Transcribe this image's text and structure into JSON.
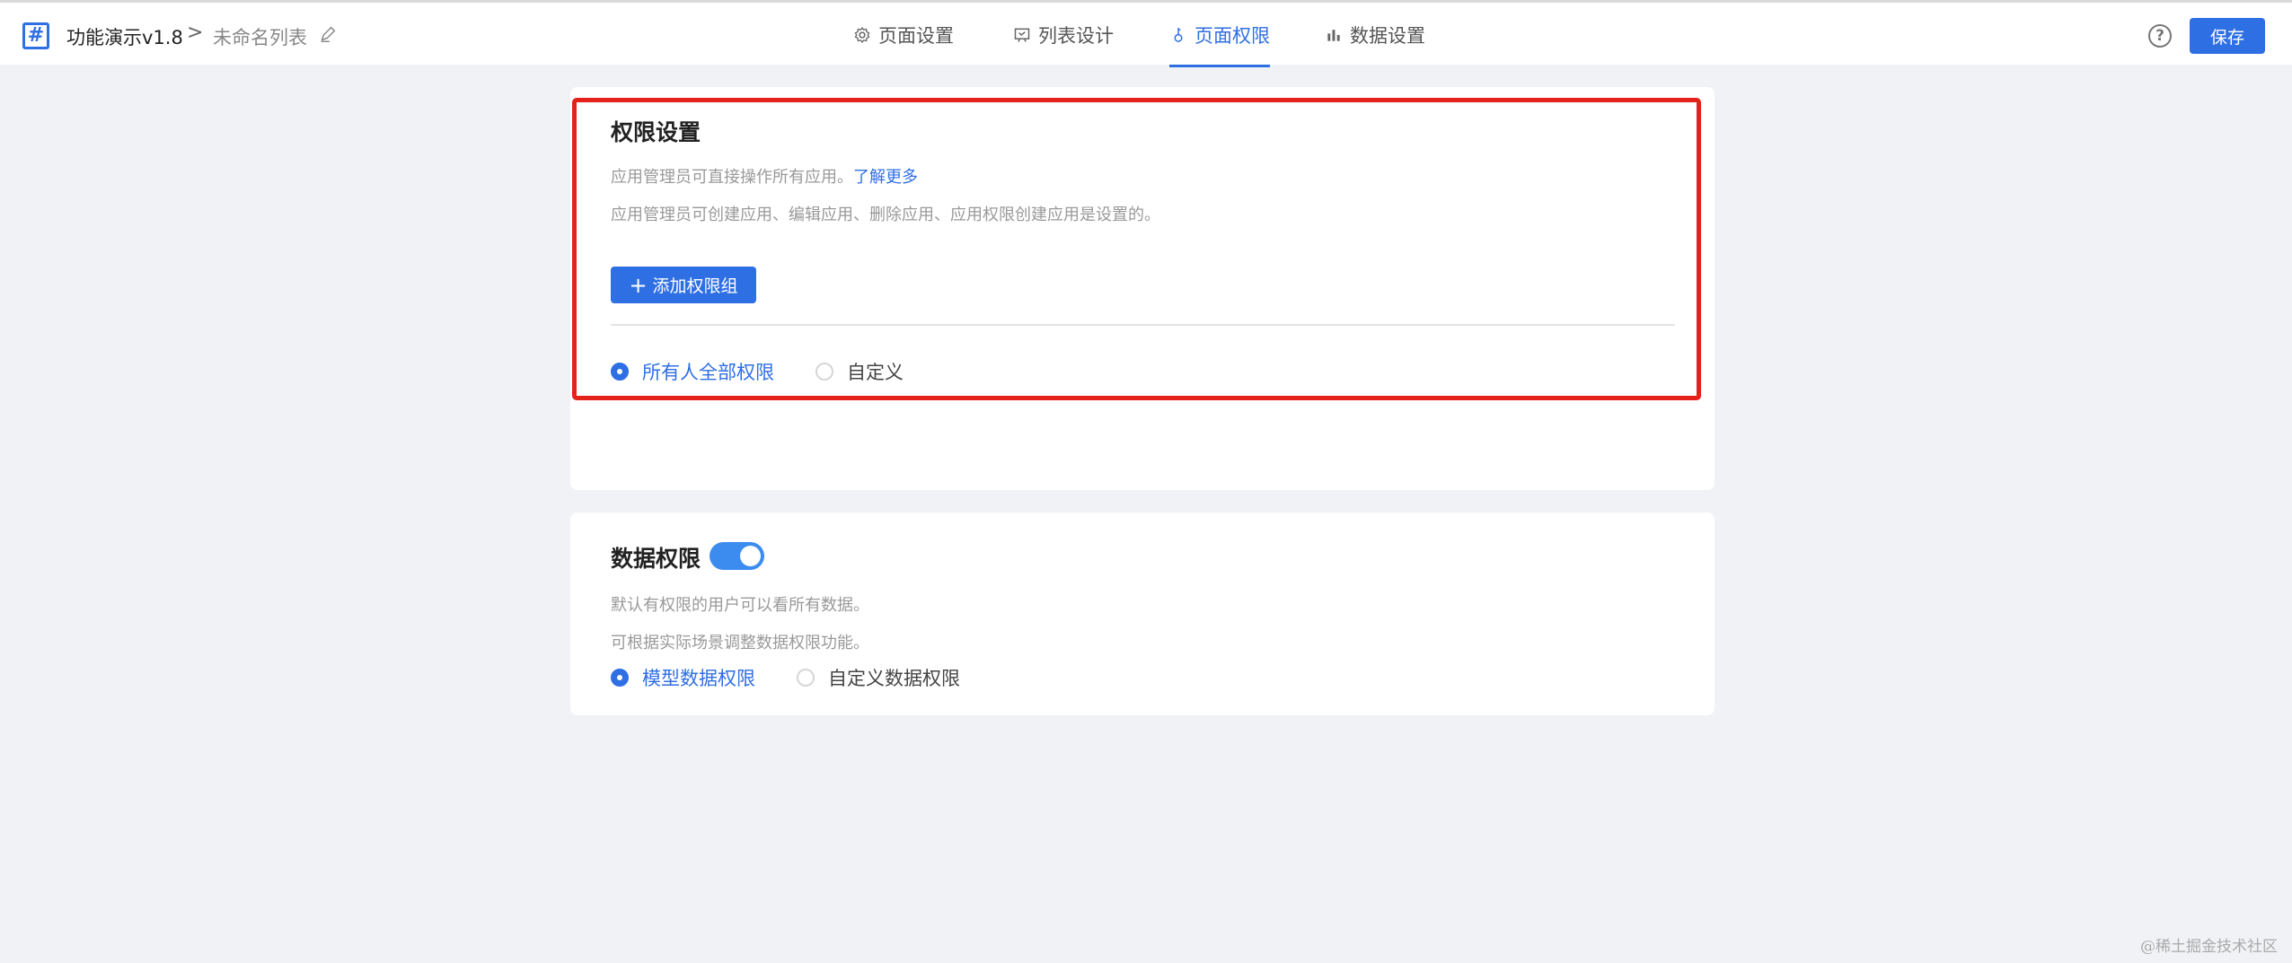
{
  "header": {
    "logo_glyph": "#",
    "app_title": "功能演示v1.8",
    "separator": ">",
    "list_name": "未命名列表",
    "tabs": [
      {
        "label": "页面设置",
        "icon": "gear-icon"
      },
      {
        "label": "列表设计",
        "icon": "list-design-icon"
      },
      {
        "label": "页面权限",
        "icon": "key-icon",
        "active": true
      },
      {
        "label": "数据设置",
        "icon": "bar-chart-icon"
      }
    ],
    "help_glyph": "?",
    "save_label": "保存"
  },
  "permission": {
    "title": "权限设置",
    "desc1": "应用管理员可直接操作所有应用。",
    "learn_more": "了解更多",
    "desc2": "应用管理员可创建应用、编辑应用、删除应用、应用权限创建应用是设置的。",
    "add_group_label": "添加权限组",
    "options": [
      {
        "label": "所有人全部权限",
        "checked": true
      },
      {
        "label": "自定义",
        "checked": false
      }
    ]
  },
  "data_permission": {
    "title": "数据权限",
    "toggle_on": true,
    "desc1": "默认有权限的用户可以看所有数据。",
    "desc2": "可根据实际场景调整数据权限功能。",
    "options": [
      {
        "label": "模型数据权限",
        "checked": true
      },
      {
        "label": "自定义数据权限",
        "checked": false
      }
    ]
  },
  "colors": {
    "accent": "#2f6fe4",
    "highlight": "#e5221a",
    "background": "#f0f2f5"
  },
  "watermark": "@稀土掘金技术社区"
}
